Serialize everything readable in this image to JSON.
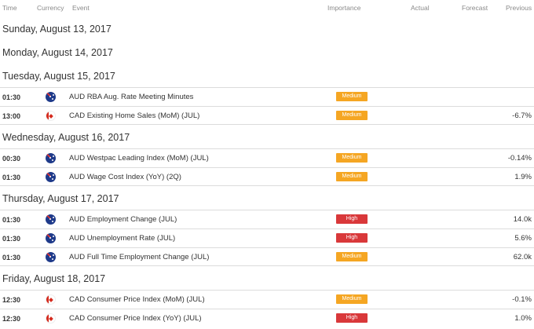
{
  "header": {
    "time": "Time",
    "currency": "Currency",
    "event": "Event",
    "importance": "Importance",
    "actual": "Actual",
    "forecast": "Forecast",
    "previous": "Previous"
  },
  "days": [
    {
      "label": "Sunday, August 13, 2017"
    },
    {
      "label": "Monday, August 14, 2017"
    },
    {
      "label": "Tuesday, August 15, 2017"
    },
    {
      "label": "Wednesday, August 16, 2017"
    },
    {
      "label": "Thursday, August 17, 2017"
    },
    {
      "label": "Friday, August 18, 2017"
    }
  ],
  "events": [
    {
      "time": "01:30",
      "flag": "australia-flag-icon",
      "event": "AUD RBA Aug. Rate Meeting Minutes",
      "importance": "Medium",
      "actual": "",
      "forecast": "",
      "previous": ""
    },
    {
      "time": "13:00",
      "flag": "canada-flag-icon",
      "event": "CAD Existing Home Sales (MoM) (JUL)",
      "importance": "Medium",
      "actual": "",
      "forecast": "",
      "previous": "-6.7%"
    },
    {
      "time": "00:30",
      "flag": "australia-flag-icon",
      "event": "AUD Westpac Leading Index (MoM) (JUL)",
      "importance": "Medium",
      "actual": "",
      "forecast": "",
      "previous": "-0.14%"
    },
    {
      "time": "01:30",
      "flag": "australia-flag-icon",
      "event": "AUD Wage Cost Index (YoY) (2Q)",
      "importance": "Medium",
      "actual": "",
      "forecast": "",
      "previous": "1.9%"
    },
    {
      "time": "01:30",
      "flag": "australia-flag-icon",
      "event": "AUD Employment Change (JUL)",
      "importance": "High",
      "actual": "",
      "forecast": "",
      "previous": "14.0k"
    },
    {
      "time": "01:30",
      "flag": "australia-flag-icon",
      "event": "AUD Unemployment Rate (JUL)",
      "importance": "High",
      "actual": "",
      "forecast": "",
      "previous": "5.6%"
    },
    {
      "time": "01:30",
      "flag": "australia-flag-icon",
      "event": "AUD Full Time Employment Change (JUL)",
      "importance": "Medium",
      "actual": "",
      "forecast": "",
      "previous": "62.0k"
    },
    {
      "time": "12:30",
      "flag": "canada-flag-icon",
      "event": "CAD Consumer Price Index (MoM) (JUL)",
      "importance": "Medium",
      "actual": "",
      "forecast": "",
      "previous": "-0.1%"
    },
    {
      "time": "12:30",
      "flag": "canada-flag-icon",
      "event": "CAD Consumer Price Index (YoY) (JUL)",
      "importance": "High",
      "actual": "",
      "forecast": "",
      "previous": "1.0%"
    }
  ],
  "colors": {
    "medium": "#f5a623",
    "high": "#d9383a",
    "divider": "#dcdcdc"
  }
}
